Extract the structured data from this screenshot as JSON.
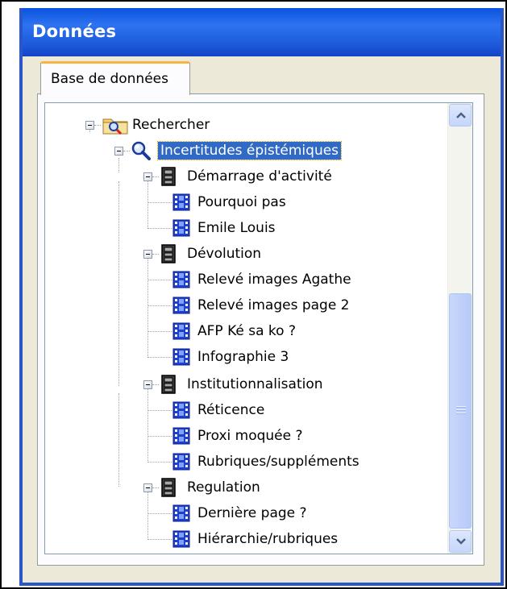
{
  "window": {
    "title": "Données"
  },
  "tabs": [
    {
      "label": "Base de données",
      "active": true
    }
  ],
  "tree": {
    "root": {
      "label": "Rechercher",
      "icon": "search-folder-icon"
    },
    "query": {
      "label": "Incertitudes épistémiques",
      "icon": "magnifier-icon",
      "selected": true
    },
    "groups": [
      {
        "label": "Démarrage d'activité",
        "icon": "cabinet-icon",
        "items": [
          "Pourquoi pas",
          "Emile Louis"
        ]
      },
      {
        "label": "Dévolution",
        "icon": "cabinet-icon",
        "items": [
          "Relevé images Agathe",
          "Relevé images page 2",
          "AFP Ké sa ko ?",
          "Infographie 3"
        ]
      },
      {
        "label": "Institutionnalisation",
        "icon": "cabinet-icon",
        "items": [
          "Réticence",
          "Proxi moquée ?",
          "Rubriques/suppléments"
        ]
      },
      {
        "label": "Regulation",
        "icon": "cabinet-icon",
        "items": [
          "Dernière page ?",
          "Hiérarchie/rubriques"
        ]
      }
    ],
    "item_icon": "film-icon"
  },
  "colors": {
    "titlebar": "#1c5bdc",
    "selection": "#316ac5",
    "tab_highlight": "#f5b541",
    "film": "#1f3fd0"
  }
}
